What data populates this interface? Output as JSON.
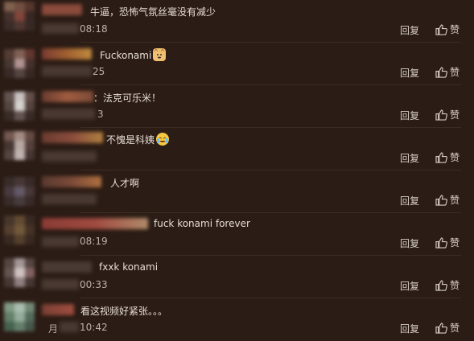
{
  "actions": {
    "reply_label": "回复",
    "like_label": "赞"
  },
  "comments": [
    {
      "text": "牛逼，恐怖气氛丝毫没有减少",
      "time": "08:18"
    },
    {
      "text": "Fuckonami",
      "time": "25",
      "emoji": "doge-emoji"
    },
    {
      "text": "：法克可乐米！",
      "time": "3"
    },
    {
      "text": "不愧是科姨",
      "time": "",
      "emoji": "crying-laugh-emoji"
    },
    {
      "text": "人才啊",
      "time": ""
    },
    {
      "text": "fuck konami forever",
      "time": "08:19"
    },
    {
      "text": "fxxk konami",
      "time": "00:33"
    },
    {
      "text": "看这视频好紧张。。。",
      "time_prefix": "月",
      "time": "10:42"
    }
  ]
}
